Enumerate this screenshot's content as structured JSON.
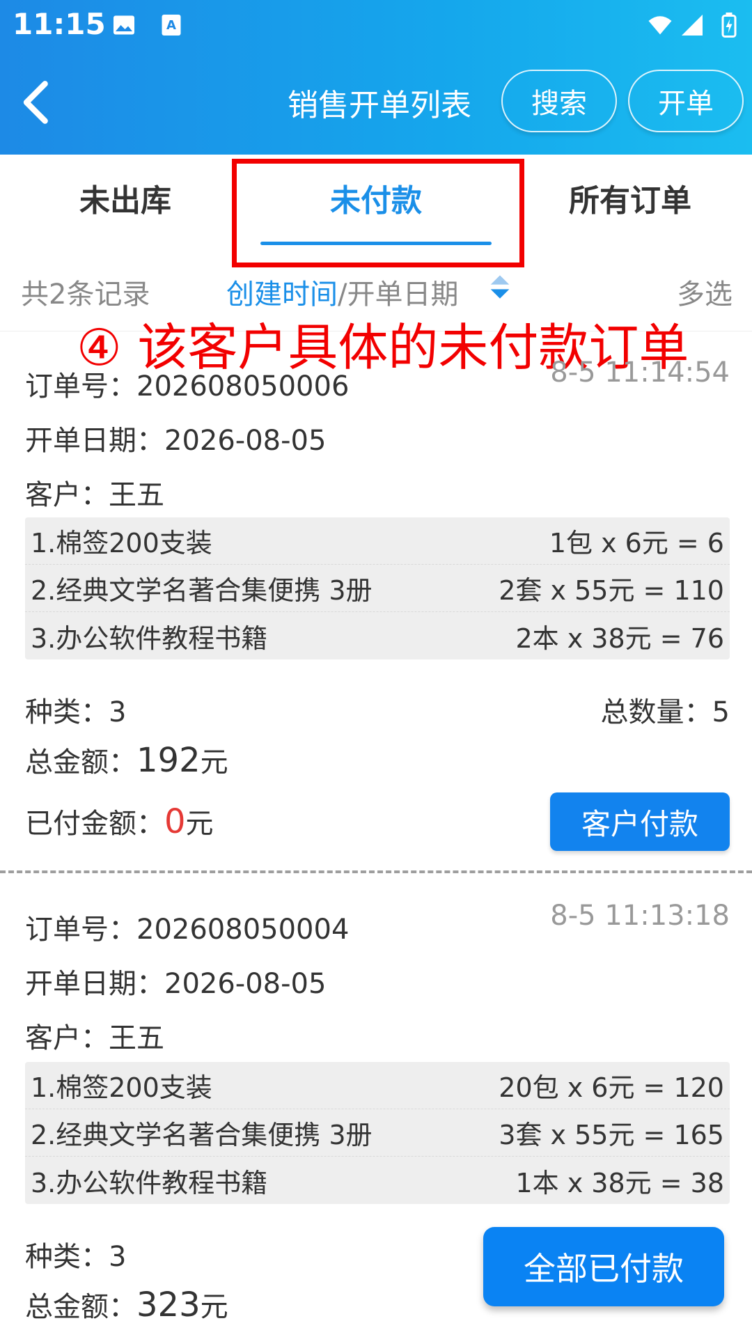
{
  "status_bar": {
    "time": "11:15"
  },
  "header": {
    "title": "销售开单列表",
    "search_label": "搜索",
    "open_label": "开单"
  },
  "tabs": [
    {
      "label": "未出库"
    },
    {
      "label": "未付款"
    },
    {
      "label": "所有订单"
    }
  ],
  "filter": {
    "record_count": "共2条记录",
    "sort_active": "创建时间",
    "sort_sep": "/",
    "sort_other": "开单日期",
    "multi_select": "多选"
  },
  "annotation": "④ 该客户具体的未付款订单",
  "orders": [
    {
      "order_no": "订单号：202608050006",
      "timestamp": "8-5 11:14:54",
      "open_date": "开单日期：2026-08-05",
      "customer": "客户：王五",
      "items": [
        {
          "name": "1.棉签200支装",
          "price": "1包 x 6元 = 6"
        },
        {
          "name": "2.经典文学名著合集便携 3册",
          "price": "2套 x 55元 = 110"
        },
        {
          "name": "3.办公软件教程书籍",
          "price": "2本 x 38元 = 76"
        }
      ],
      "types": "种类：3",
      "total_qty": "总数量：5",
      "total_label": "总金额：",
      "total_amount": "192",
      "unit": "元",
      "paid_label": "已付金额：",
      "paid_amount": "0",
      "pay_button": "客户付款"
    },
    {
      "order_no": "订单号：202608050004",
      "timestamp": "8-5 11:13:18",
      "open_date": "开单日期：2026-08-05",
      "customer": "客户：王五",
      "items": [
        {
          "name": "1.棉签200支装",
          "price": "20包 x 6元 = 120"
        },
        {
          "name": "2.经典文学名著合集便携 3册",
          "price": "3套 x 55元 = 165"
        },
        {
          "name": "3.办公软件教程书籍",
          "price": "1本 x 38元 = 38"
        }
      ],
      "types": "种类：3",
      "total_label": "总金额：",
      "total_amount": "323",
      "unit": "元"
    }
  ],
  "float_button": "全部已付款",
  "colors": {
    "accent": "#1a8fe8",
    "annotation": "#f20000",
    "button": "#1283ee"
  }
}
